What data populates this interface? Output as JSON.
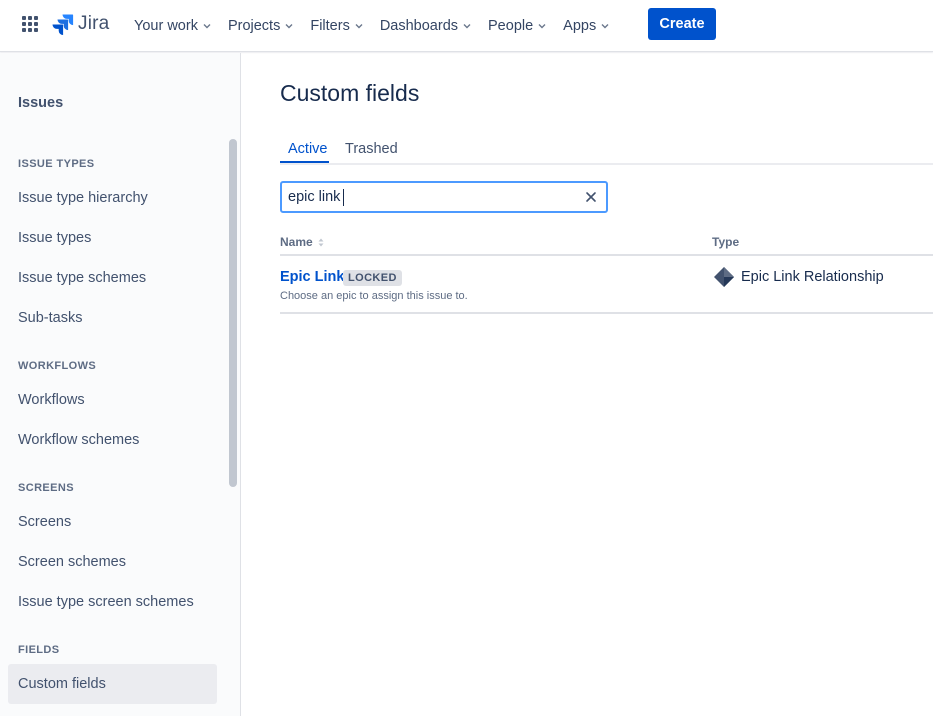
{
  "topnav": {
    "app_name": "Jira",
    "nav_items": [
      {
        "label": "Your work"
      },
      {
        "label": "Projects"
      },
      {
        "label": "Filters"
      },
      {
        "label": "Dashboards"
      },
      {
        "label": "People"
      },
      {
        "label": "Apps"
      }
    ],
    "create_label": "Create"
  },
  "sidebar": {
    "title": "Issues",
    "sections": [
      {
        "heading": "ISSUE TYPES",
        "items": [
          "Issue type hierarchy",
          "Issue types",
          "Issue type schemes",
          "Sub-tasks"
        ]
      },
      {
        "heading": "WORKFLOWS",
        "items": [
          "Workflows",
          "Workflow schemes"
        ]
      },
      {
        "heading": "SCREENS",
        "items": [
          "Screens",
          "Screen schemes",
          "Issue type screen schemes"
        ]
      },
      {
        "heading": "FIELDS",
        "items": [
          "Custom fields"
        ]
      }
    ],
    "selected_item": "Custom fields"
  },
  "main": {
    "title": "Custom fields",
    "tabs": [
      {
        "label": "Active",
        "active": true
      },
      {
        "label": "Trashed",
        "active": false
      }
    ],
    "search": {
      "value": "epic link",
      "placeholder": ""
    },
    "table": {
      "headers": {
        "name": "Name",
        "type": "Type"
      },
      "rows": [
        {
          "name": "Epic Link",
          "badge": "LOCKED",
          "description": "Choose an epic to assign this issue to.",
          "type": "Epic Link Relationship",
          "type_icon": "jira-diamond-icon"
        }
      ]
    }
  },
  "colors": {
    "accent": "#0052cc",
    "focus_ring": "#4c9aff",
    "text_primary": "#172b4d",
    "text_subtle": "#5e6c84"
  }
}
